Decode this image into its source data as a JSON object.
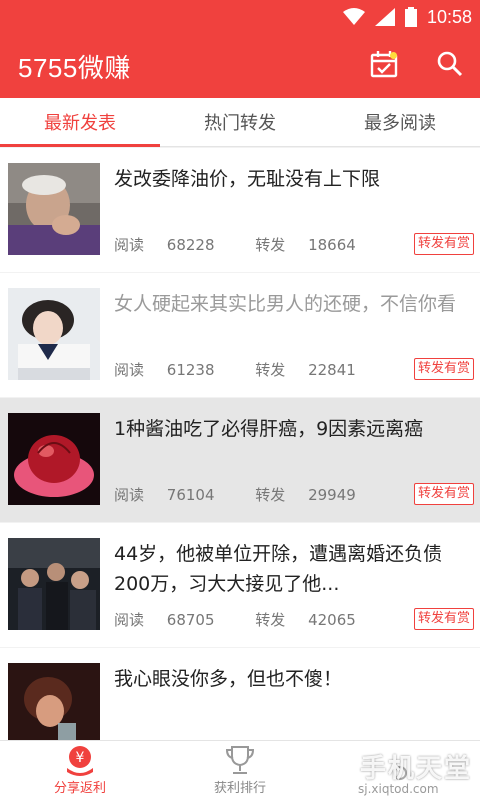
{
  "status_bar": {
    "time": "10:58"
  },
  "app_bar": {
    "title": "5755微赚",
    "accent_color": "#f0413e",
    "icons": [
      "calendar-check-icon",
      "search-icon"
    ]
  },
  "tabs": [
    {
      "label": "最新发表",
      "active": true
    },
    {
      "label": "热门转发",
      "active": false
    },
    {
      "label": "最多阅读",
      "active": false
    }
  ],
  "articles": [
    {
      "title": "发改委降油价，无耻没有上下限",
      "read_label": "阅读",
      "reads": "68228",
      "share_label": "转发",
      "shares": "18664",
      "badge": "转发有赏",
      "visited": false
    },
    {
      "title": "女人硬起来其实比男人的还硬，不信你看",
      "read_label": "阅读",
      "reads": "61238",
      "share_label": "转发",
      "shares": "22841",
      "badge": "转发有赏",
      "visited": true
    },
    {
      "title": "1种酱油吃了必得肝癌，9因素远离癌",
      "read_label": "阅读",
      "reads": "76104",
      "share_label": "转发",
      "shares": "29949",
      "badge": "转发有赏",
      "visited": false
    },
    {
      "title": "44岁，他被单位开除，遭遇离婚还负债200万，习大大接见了他...",
      "read_label": "阅读",
      "reads": "68705",
      "share_label": "转发",
      "shares": "42065",
      "badge": "转发有赏",
      "visited": false
    },
    {
      "title": "我心眼没你多，但也不傻！",
      "read_label": "",
      "reads": "",
      "share_label": "",
      "shares": "",
      "badge": "",
      "visited": false
    }
  ],
  "bottom_nav": [
    {
      "label": "分享返利",
      "icon": "share-rebate-icon",
      "active": true
    },
    {
      "label": "获利排行",
      "icon": "trophy-icon",
      "active": false
    }
  ],
  "watermark": {
    "main": "手机天堂",
    "sub": "sj.xiqtod.com"
  }
}
